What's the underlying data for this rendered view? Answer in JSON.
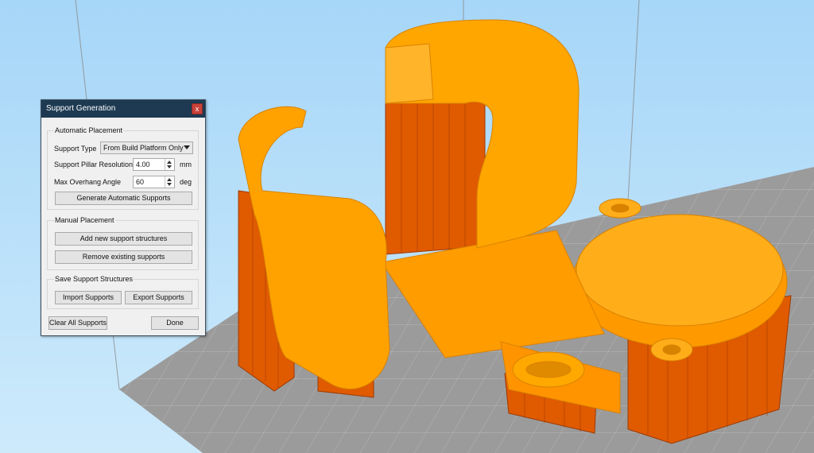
{
  "dialog": {
    "title": "Support Generation",
    "close_label": "x",
    "automatic": {
      "legend": "Automatic Placement",
      "support_type_label": "Support Type",
      "support_type_value": "From Build Platform Only",
      "pillar_resolution_label": "Support Pillar Resolution",
      "pillar_resolution_value": "4.00",
      "pillar_resolution_unit": "mm",
      "overhang_label": "Max Overhang Angle",
      "overhang_value": "60",
      "overhang_unit": "deg",
      "generate_label": "Generate Automatic Supports"
    },
    "manual": {
      "legend": "Manual Placement",
      "add_label": "Add new support structures",
      "remove_label": "Remove existing supports"
    },
    "save": {
      "legend": "Save Support Structures",
      "import_label": "Import Supports",
      "export_label": "Export Supports"
    },
    "clear_label": "Clear All Supports",
    "done_label": "Done"
  },
  "colors": {
    "background_sky": "#a9d9f8",
    "build_plate": "#9a9a9a",
    "model": "#ffa000",
    "supports": "#e05a00",
    "titlebar": "#1d3a52",
    "close_button": "#c9423a"
  }
}
